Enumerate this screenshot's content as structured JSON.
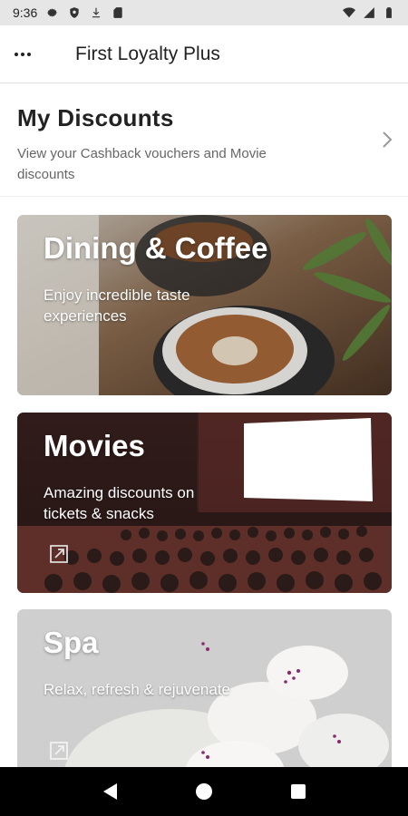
{
  "status_bar": {
    "time": "9:36",
    "icons_left": [
      "settings-icon",
      "shield-icon",
      "download-icon",
      "sd-card-icon"
    ],
    "icons_right": [
      "wifi-icon",
      "signal-icon",
      "battery-icon"
    ]
  },
  "app_bar": {
    "title": "First Loyalty Plus",
    "menu_icon": "more-horizontal-icon"
  },
  "discounts": {
    "title": "My Discounts",
    "subtitle": "View your Cashback vouchers and Movie discounts"
  },
  "cards": [
    {
      "title": "Dining & Coffee",
      "description": "Enjoy incredible taste experiences"
    },
    {
      "title": "Movies",
      "description": "Amazing discounts on tickets & snacks",
      "icon": "external-link-icon"
    },
    {
      "title": "Spa",
      "description": "Relax, refresh & rejuvenate",
      "icon": "external-link-icon"
    }
  ],
  "nav_bar": {
    "buttons": [
      "back-icon",
      "home-icon",
      "recents-icon"
    ]
  },
  "colors": {
    "nav_bar": "#000000",
    "status_bar": "#e6e6e6",
    "text_primary": "#222222",
    "text_secondary": "#666666"
  }
}
